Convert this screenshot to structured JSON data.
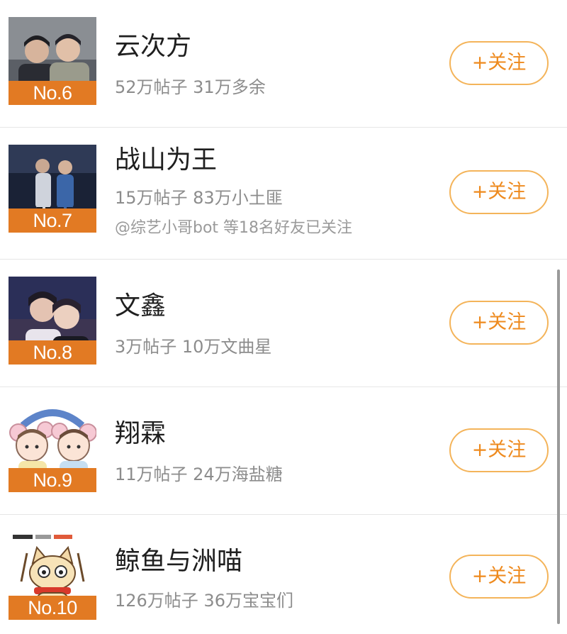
{
  "follow_label": "+关注",
  "accent_color": "#e27a23",
  "follow_color": "#ee8a1e",
  "items": [
    {
      "rank": "No.6",
      "title": "云次方",
      "stats": "52万帖子 31万多余",
      "friends": "",
      "thumb": "two-men-photo"
    },
    {
      "rank": "No.7",
      "title": "战山为王",
      "stats": "15万帖子 83万小土匪",
      "friends": "@综艺小哥bot 等18名好友已关注",
      "thumb": "two-men-stage-photo"
    },
    {
      "rank": "No.8",
      "title": "文鑫",
      "stats": "3万帖子 10万文曲星",
      "friends": "",
      "thumb": "two-boys-photo"
    },
    {
      "rank": "No.9",
      "title": "翔霖",
      "stats": "11万帖子 24万海盐糖",
      "friends": "",
      "thumb": "cartoon-mice-illustration"
    },
    {
      "rank": "No.10",
      "title": "鲸鱼与洲喵",
      "stats": "126万帖子 36万宝宝们",
      "friends": "",
      "thumb": "cartoon-cat-illustration"
    }
  ]
}
